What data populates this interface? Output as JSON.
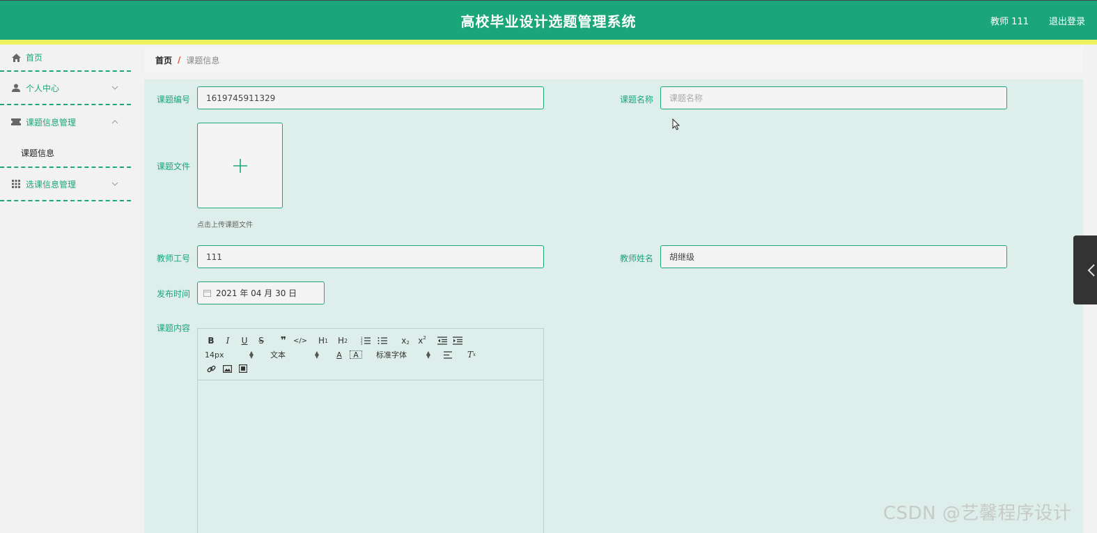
{
  "header": {
    "title": "高校毕业设计选题管理系统",
    "user": "教师 111",
    "logout": "退出登录"
  },
  "sidebar": {
    "items": [
      {
        "label": "首页",
        "icon": "home-icon"
      },
      {
        "label": "个人中心",
        "icon": "user-icon"
      },
      {
        "label": "课题信息管理",
        "icon": "ticket-icon",
        "expanded": true,
        "children": [
          "课题信息"
        ]
      },
      {
        "label": "选课信息管理",
        "icon": "grid-icon"
      }
    ]
  },
  "breadcrumb": {
    "home": "首页",
    "separator": "/",
    "current": "课题信息"
  },
  "form": {
    "topic_no_label": "课题编号",
    "topic_no_value": "1619745911329",
    "topic_name_label": "课题名称",
    "topic_name_placeholder": "课题名称",
    "topic_file_label": "课题文件",
    "upload_hint": "点击上传课题文件",
    "teacher_no_label": "教师工号",
    "teacher_no_value": "111",
    "teacher_name_label": "教师姓名",
    "teacher_name_value": "胡继级",
    "publish_time_label": "发布时间",
    "publish_time_value": "2021 年 04 月 30 日",
    "content_label": "课题内容"
  },
  "editor": {
    "font_size": "14px",
    "header_select": "文本",
    "font_family": "标准字体",
    "buttons": [
      "B",
      "I",
      "U",
      "S",
      "quote",
      "code",
      "H1",
      "H2",
      "ordered-list",
      "bullet-list",
      "subscript",
      "superscript",
      "outdent",
      "indent",
      "font-color",
      "background-color",
      "align",
      "clean",
      "link",
      "image",
      "video"
    ]
  },
  "watermark": "CSDN @艺馨程序设计",
  "colors": {
    "primary": "#1ba67a",
    "accent_bar": "#ecf35e",
    "panel_bg": "#deeeea"
  }
}
